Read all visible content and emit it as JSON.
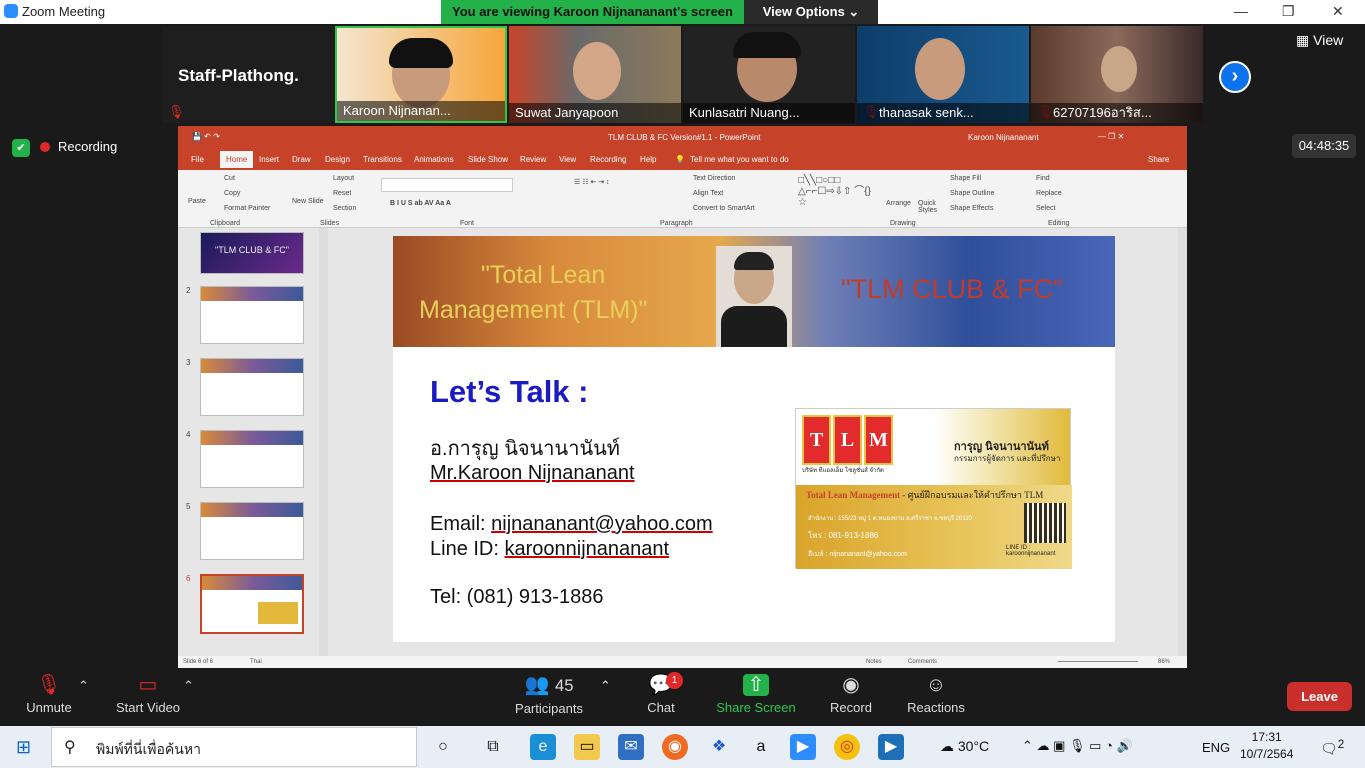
{
  "window": {
    "title": "Zoom Meeting"
  },
  "share_banner": {
    "viewing": "You are viewing Karoon Nijnananant's screen",
    "view_options": "View Options ⌄"
  },
  "participants_strip": {
    "staff_name": "Staff-Plathong.",
    "tiles": [
      {
        "name": "Karoon Nijnanan..."
      },
      {
        "name": "Suwat Janyapoon"
      },
      {
        "name": "Kunlasatri Nuang..."
      },
      {
        "name": "thanasak senk..."
      },
      {
        "name": "62707196อาริส..."
      }
    ],
    "view_label": "View"
  },
  "recording": {
    "label": "Recording",
    "timer": "04:48:35"
  },
  "ppt": {
    "doc_title": "TLM CLUB & FC Version#1.1  -  PowerPoint",
    "user": "Karoon Nijnananant",
    "tabs": [
      "File",
      "Home",
      "Insert",
      "Draw",
      "Design",
      "Transitions",
      "Animations",
      "Slide Show",
      "Review",
      "View",
      "Recording",
      "Help"
    ],
    "tell_me": "Tell me what you want to do",
    "share": "Share",
    "groups": {
      "clipboard": "Clipboard",
      "slides": "Slides",
      "font": "Font",
      "paragraph": "Paragraph",
      "drawing": "Drawing",
      "editing": "Editing"
    },
    "ribbon": {
      "cut": "Cut",
      "copy": "Copy",
      "format_painter": "Format Painter",
      "paste": "Paste",
      "new_slide": "New Slide",
      "layout": "Layout",
      "reset": "Reset",
      "section": "Section",
      "find": "Find",
      "replace": "Replace",
      "select": "Select",
      "arrange": "Arrange",
      "quick_styles": "Quick Styles",
      "shape_fill": "Shape Fill",
      "shape_outline": "Shape Outline",
      "shape_effects": "Shape Effects",
      "text_direction": "Text Direction",
      "align_text": "Align Text",
      "convert_smartart": "Convert to SmartArt"
    },
    "thumbs": [
      {
        "num": "2"
      },
      {
        "num": "3"
      },
      {
        "num": "4"
      },
      {
        "num": "5"
      },
      {
        "num": "6"
      }
    ],
    "first_thumb_text": "\"TLM CLUB & FC\"",
    "status": {
      "slide_of": "Slide 6 of 6",
      "lang": "Thai",
      "notes": "Notes",
      "comments": "Comments",
      "zoom": "86%"
    },
    "slide": {
      "banner_left_1": "\"Total Lean",
      "banner_left_2": "Management (TLM)\"",
      "banner_right": "\"TLM CLUB & FC\"",
      "title": "Let’s Talk :",
      "name_th": "อ.การุญ นิจนานานันท์",
      "name_en": "Mr.Karoon Nijnananant",
      "email_label": "Email: ",
      "email": "nijnananant@yahoo.com",
      "line_label": "Line ID: ",
      "line_id": "karoonnijnananant",
      "tel": "Tel: (081) 913-1886",
      "card": {
        "letters": [
          "T",
          "L",
          "M"
        ],
        "name_th": "การุญ นิจนานานันท์",
        "role_th": "กรรมการผู้จัดการ และที่ปรึกษา",
        "company_th": "บริษัท ทีแอลเอ็ม โซลูชั่นส์ จำกัด",
        "tagline_brand": "Total Lean Management",
        "tagline_rest": " - ศูนย์ฝึกอบรมและให้คำปรึกษา TLM",
        "address": "สำนักงาน : 155/23 หมู่ 1 ต.หนองขาม อ.ศรีราชา จ.ชลบุรี 20110",
        "phone": "โทร : 081-913-1886",
        "email": "อีเมล์ : nijnananant@yahoo.com",
        "line": "LINE ID : karoonnijnananant"
      }
    }
  },
  "controls": {
    "unmute": "Unmute",
    "start_video": "Start Video",
    "participants": "Participants",
    "participants_count": "45",
    "chat": "Chat",
    "chat_badge": "1",
    "share_screen": "Share Screen",
    "record": "Record",
    "reactions": "Reactions",
    "leave": "Leave"
  },
  "taskbar": {
    "search_placeholder": "พิมพ์ที่นี่เพื่อค้นหา",
    "temp": "30°C",
    "lang": "ENG",
    "time": "17:31",
    "date": "10/7/2564",
    "notif": "2"
  }
}
